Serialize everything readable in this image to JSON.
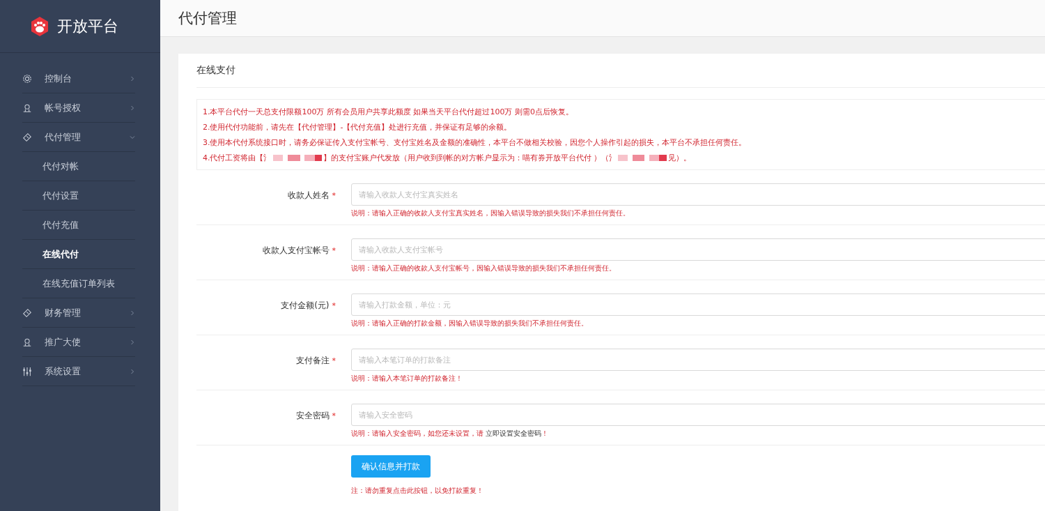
{
  "brand": {
    "name": "开放平台"
  },
  "sidebar": {
    "items": [
      {
        "label": "控制台",
        "expanded": false
      },
      {
        "label": "帐号授权",
        "expanded": false
      },
      {
        "label": "代付管理",
        "expanded": true,
        "children": [
          {
            "label": "代付对帐",
            "selected": false
          },
          {
            "label": "代付设置",
            "selected": false
          },
          {
            "label": "代付充值",
            "selected": false
          },
          {
            "label": "在线代付",
            "selected": true
          },
          {
            "label": "在线充值订单列表",
            "selected": false
          }
        ]
      },
      {
        "label": "财务管理",
        "expanded": false
      },
      {
        "label": "推广大使",
        "expanded": false
      },
      {
        "label": "系统设置",
        "expanded": false
      }
    ]
  },
  "page_title": "代付管理",
  "card": {
    "title": "在线支付",
    "notices": [
      {
        "parts": [
          "1.本平台代付一天总支付限额100万 所有会员用户共享此额度 如果当天平台代付超过100万 则需0点后恢复。"
        ]
      },
      {
        "parts": [
          "2.使用代付功能前，请先在【代付管理】-【代付充值】处进行充值，并保证有足够的余额。"
        ]
      },
      {
        "parts": [
          "3.使用本代付系统接口时，请务必保证传入支付宝帐号、支付宝姓名及金额的准确性，本平台不做相关校验，因您个人操作引起的损失，本平台不承担任何责任。"
        ]
      },
      {
        "parts": [
          "4.代付工资将由【氵",
          "】的支付宝账户代发放（用户收到到帐的对方帐户显示为：喵有券开放平台代付 ）（氵",
          "见）。"
        ]
      }
    ],
    "fields": [
      {
        "label": "收款人姓名",
        "marker": "*",
        "placeholder": "请输入收款人支付宝真实姓名",
        "hint": "说明：请输入正确的收款人支付宝真实姓名，因输入错误导致的损失我们不承担任何责任。"
      },
      {
        "label": "收款人支付宝帐号",
        "marker": "*",
        "placeholder": "请输入收款人支付宝帐号",
        "hint": "说明：请输入正确的收款人支付宝帐号，因输入错误导致的损失我们不承担任何责任。"
      },
      {
        "label": "支付金额(元)",
        "marker": "*",
        "placeholder": "请输入打款金额，单位：元",
        "hint": "说明：请输入正确的打款金额，因输入错误导致的损失我们不承担任何责任。"
      },
      {
        "label": "支付备注",
        "marker": "*",
        "placeholder": "请输入本笔订单的打款备注",
        "hint": "说明：请输入本笔订单的打款备注！"
      },
      {
        "label": "安全密码",
        "marker": "*",
        "placeholder": "请输入安全密码",
        "hint": "说明：请输入安全密码，如您还未设置，请 ",
        "hint_link": "立即设置安全密码",
        "hint_end": "！"
      }
    ],
    "submit": "确认信息并打款",
    "footnote": "注：请勿重复点击此按钮，以免打款重复！"
  }
}
